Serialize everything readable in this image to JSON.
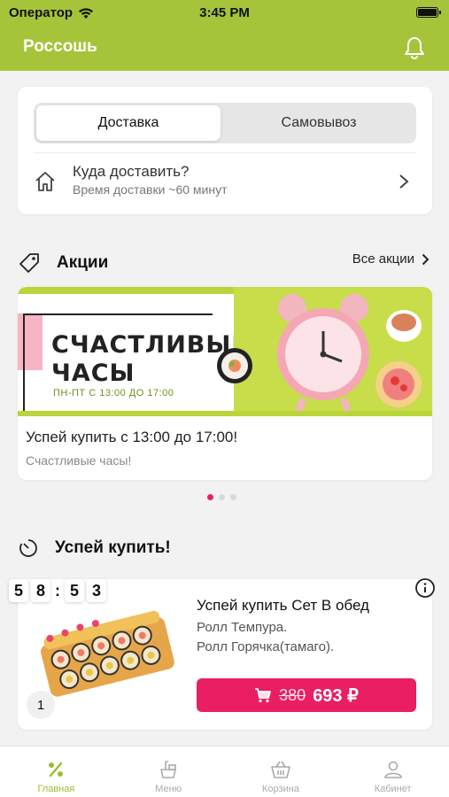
{
  "status_bar": {
    "carrier": "Оператор",
    "time": "3:45 PM"
  },
  "header": {
    "city": "Россошь"
  },
  "delivery": {
    "tabs": [
      "Доставка",
      "Самовывоз"
    ],
    "selected_tab": "Доставка",
    "address_title": "Куда доставить?",
    "address_subtitle": "Время доставки ~60 минут"
  },
  "promos": {
    "title": "Акции",
    "all_link": "Все акции",
    "banner_headline": "СЧАСТЛИВЫЕ ЧАСЫ",
    "banner_hours": "ПН-ПТ С 13:00 ДО 17:00",
    "item_title": "Успей купить с 13:00 до 17:00!",
    "item_subtitle": "Счастливые часы!",
    "pager_total": 3,
    "pager_active": 1
  },
  "hurry": {
    "title": "Успей купить!",
    "timer": [
      "5",
      "8",
      "5",
      "3"
    ],
    "product_title": "Успей купить Сет В обед",
    "product_desc_line1": "Ролл Темпура.",
    "product_desc_line2": "Ролл Горячка(тамаго).",
    "quantity": "1",
    "old_price": "380",
    "new_price": "693 ₽"
  },
  "tab_bar": {
    "items": [
      {
        "label": "Главная",
        "icon": "percent-icon",
        "active": true
      },
      {
        "label": "Меню",
        "icon": "menu-icon",
        "active": false
      },
      {
        "label": "Корзина",
        "icon": "basket-icon",
        "active": false
      },
      {
        "label": "Кабинет",
        "icon": "user-icon",
        "active": false
      }
    ]
  },
  "colors": {
    "brand_green": "#a6c43a",
    "accent_pink": "#e91e63"
  }
}
